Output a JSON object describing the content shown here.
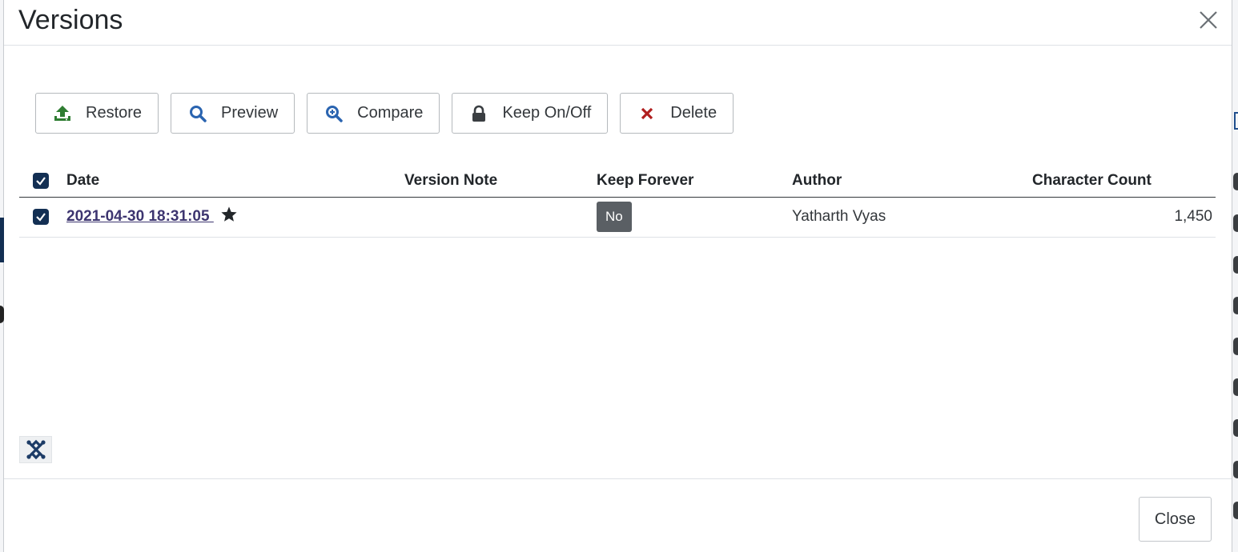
{
  "modal": {
    "title": "Versions",
    "close_icon": "close-icon"
  },
  "toolbar": {
    "buttons": [
      {
        "label": "Restore",
        "icon": "upload-icon",
        "color": "#2f7d32"
      },
      {
        "label": "Preview",
        "icon": "search-icon",
        "color": "#2a64b0"
      },
      {
        "label": "Compare",
        "icon": "zoom-in-icon",
        "color": "#2a64b0"
      },
      {
        "label": "Keep On/Off",
        "icon": "lock-icon",
        "color": "#33373b"
      },
      {
        "label": "Delete",
        "icon": "x-icon",
        "color": "#b01e1e"
      }
    ]
  },
  "table": {
    "headers": {
      "date": "Date",
      "version_note": "Version Note",
      "keep_forever": "Keep Forever",
      "author": "Author",
      "character_count": "Character Count"
    },
    "rows": [
      {
        "checked": true,
        "date": "2021-04-30 18:31:05",
        "current_icon": "star-icon",
        "version_note": "",
        "keep_forever": "No",
        "author": "Yatharth Vyas",
        "character_count": "1,450"
      }
    ]
  },
  "footer": {
    "close_label": "Close"
  },
  "colors": {
    "checkbox": "#132f53",
    "link": "#3d3570",
    "badge": "#5a5f64"
  }
}
